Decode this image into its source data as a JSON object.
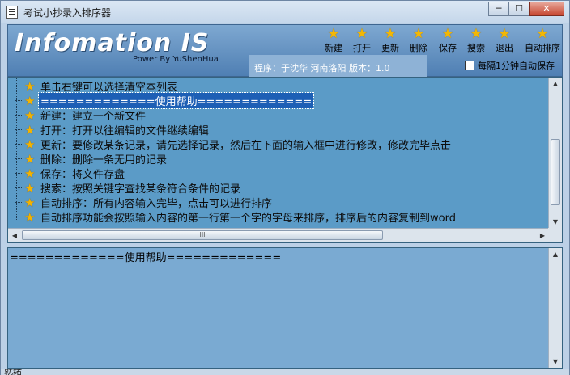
{
  "window": {
    "title": "考试小抄录入排序器",
    "minimize": "─",
    "maximize": "☐",
    "close": "✕"
  },
  "banner": {
    "logo": "Infomation IS",
    "powered_by": "Power By YuShenHua",
    "info": "程序：于沈华   河南洛阳   版本：1.0",
    "toolbar": [
      {
        "label": "新建",
        "icon": "star-icon"
      },
      {
        "label": "打开",
        "icon": "star-icon"
      },
      {
        "label": "更新",
        "icon": "star-icon"
      },
      {
        "label": "删除",
        "icon": "star-icon"
      },
      {
        "label": "保存",
        "icon": "star-icon"
      },
      {
        "label": "搜索",
        "icon": "star-icon"
      },
      {
        "label": "退出",
        "icon": "star-icon"
      },
      {
        "label": "自动排序",
        "icon": "star-icon"
      }
    ],
    "autosave_label": "每隔1分钟自动保存",
    "autosave_checked": false
  },
  "tree": {
    "items": [
      {
        "text": "单击右键可以选择清空本列表",
        "selected": false
      },
      {
        "text": "=============使用帮助=============",
        "selected": true
      },
      {
        "text": "新建：建立一个新文件",
        "selected": false
      },
      {
        "text": "打开：打开以往编辑的文件继续编辑",
        "selected": false
      },
      {
        "text": "更新：要修改某条记录，请先选择记录，然后在下面的输入框中进行修改，修改完毕点击",
        "selected": false
      },
      {
        "text": "删除：删除一条无用的记录",
        "selected": false
      },
      {
        "text": "保存：将文件存盘",
        "selected": false
      },
      {
        "text": "搜索：按照关键字查找某条符合条件的记录",
        "selected": false
      },
      {
        "text": "自动排序：所有内容输入完毕，点击可以进行排序",
        "selected": false
      },
      {
        "text": "自动排序功能会按照输入内容的第一行第一个字的字母来排序，排序后的内容复制到word",
        "selected": false
      }
    ],
    "hscroll_grip": "III"
  },
  "editor": {
    "content": "=============使用帮助============="
  },
  "status": {
    "text": "就绪"
  }
}
